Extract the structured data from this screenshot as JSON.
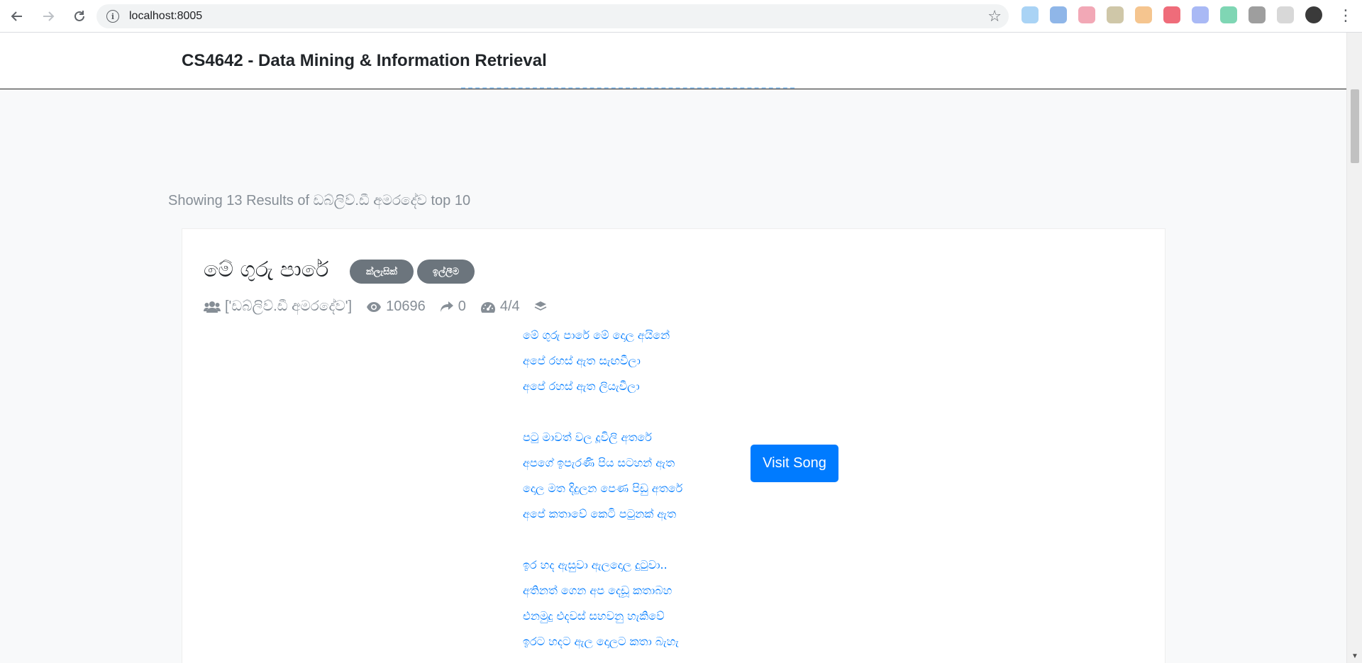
{
  "browser": {
    "url": "localhost:8005",
    "extension_colors": [
      "#a9d3f5",
      "#8fb6e8",
      "#f2a8b6",
      "#cfc7a8",
      "#f5c58f",
      "#ef6c7a",
      "#a9b9f5",
      "#7fd6b4",
      "#9e9e9e",
      "#d8d8d8"
    ]
  },
  "navbar": {
    "brand": "CS4642 - Data Mining & Information Retrieval"
  },
  "results": {
    "header": "Showing 13 Results of ඩබ්ලිව්.ඩී අමරදේව top 10"
  },
  "song": {
    "title": "මේ ගුරු පාරේ",
    "badges": [
      "ක්ලැසික්",
      "ඉල්ලීම"
    ],
    "artists": "['ඩබ්ලිව්.ඩී අමරදේව']",
    "views": "10696",
    "shares": "0",
    "rating": "4/4",
    "lyrics": [
      "මේ ගුරු පාරේ මේ දොල අයිනේ",
      "අපේ රහස් ඇත සැඟවීලා",
      "අපේ රහස් ඇත ලියැවීලා",
      "",
      "පටු මාවත් වල දූවිලි අතරේ",
      "අපගේ ඉපැරණි පිය සටහන් ඇත",
      "දොල මත දිදුලන පෙණ පිඩු අතරේ",
      "අපේ කතාවේ කෙටි පටුනක් ඇත",
      "",
      "ඉර හද ඇසුවා ඇලදොල දුටුවා..",
      "අතිනත් ගෙන අප දෙඩූ කතාබහ",
      "එනමුදු එදවස් සහවනු හැකිවේ",
      "ඉරට හදට ඇල දොලට කතා බැහැ"
    ],
    "visit_label": "Visit Song"
  }
}
